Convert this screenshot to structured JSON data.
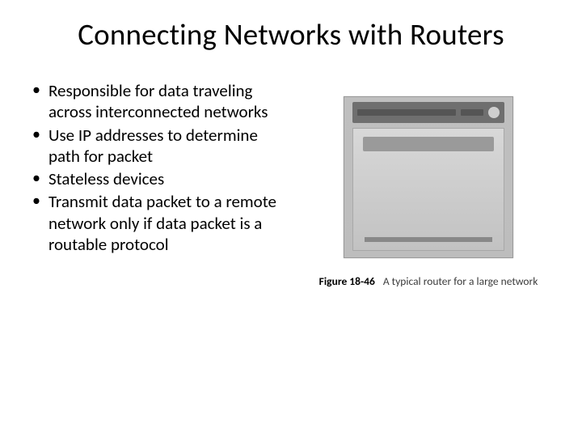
{
  "title": "Connecting Networks with Routers",
  "bullets": [
    "Responsible for data traveling across interconnected networks",
    "Use IP addresses to determine path for packet",
    "Stateless devices",
    "Transmit data packet to a remote network only if data packet is a routable protocol"
  ],
  "figure": {
    "label": "Figure 18-46",
    "caption": "A typical router for a large network"
  }
}
